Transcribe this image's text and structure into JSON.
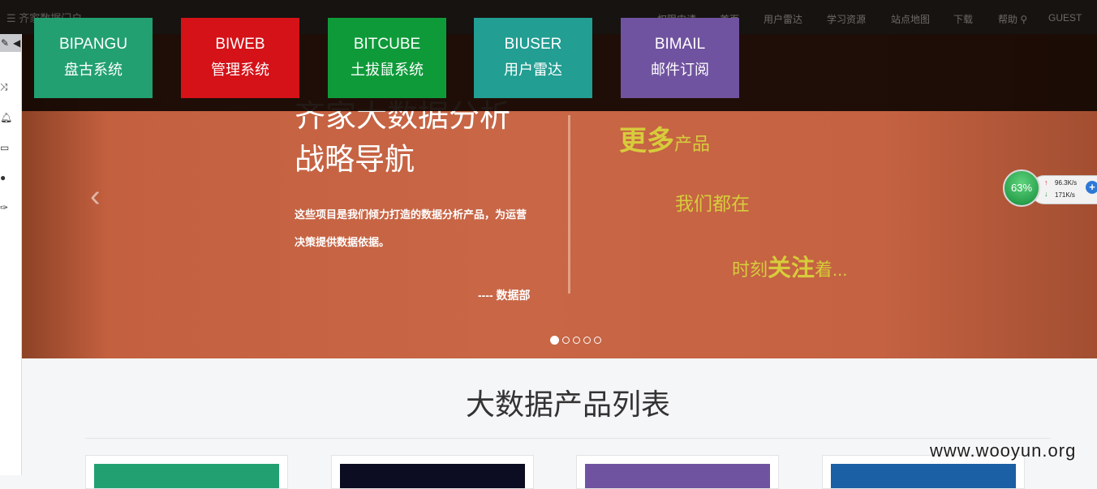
{
  "navbar": {
    "brand": "齐家数据门户",
    "links": [
      "权限申请",
      "首页",
      "用户雷达",
      "学习资源",
      "站点地图",
      "下载",
      "帮助",
      "GUEST"
    ]
  },
  "tiles": [
    {
      "en": "BIPANGU",
      "zh": "盘古系统",
      "color": "#22a071"
    },
    {
      "en": "BIWEB",
      "zh": "管理系统",
      "color": "#d41218"
    },
    {
      "en": "BITCUBE",
      "zh": "土拔鼠系统",
      "color": "#0f9a3a"
    },
    {
      "en": "BIUSER",
      "zh": "用户雷达",
      "color": "#229e92"
    },
    {
      "en": "BIMAIL",
      "zh": "邮件订阅",
      "color": "#7053a0"
    }
  ],
  "hero": {
    "title_line1": "齐家大数据分析",
    "title_line2": "战略导航",
    "desc_line1": "这些项目是我们倾力打造的数据分析产品，为运营",
    "desc_line2": "决策提供数据依据。",
    "signature": "----  数据部",
    "tagline": {
      "more_big": "更多",
      "more_small": "产品",
      "we": "我们都在",
      "time_a": "时刻",
      "time_b": "关注",
      "time_c": "着..."
    },
    "slides_count": 5,
    "active_slide": 1
  },
  "speed_widget": {
    "percent": "63%",
    "up": "96.3K/s",
    "down": "171K/s"
  },
  "section": {
    "title": "大数据产品列表",
    "card_colors": [
      "#22a071",
      "#0c0d22",
      "#7053a0",
      "#1b5fa4"
    ]
  },
  "watermark": "www.wooyun.org"
}
